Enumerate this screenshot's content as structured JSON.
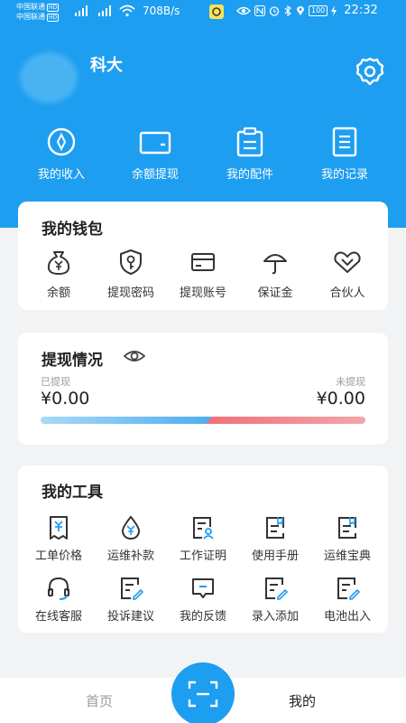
{
  "status_bar": {
    "carrier1": "中国联通",
    "carrier2": "中国联通",
    "hd": "HD",
    "net_speed": "708B/s",
    "battery": "100",
    "time": "22:32"
  },
  "header": {
    "user_name": "科大",
    "quick_actions": [
      {
        "label": "我的收入",
        "icon": "income-icon"
      },
      {
        "label": "余额提现",
        "icon": "wallet-icon"
      },
      {
        "label": "我的配件",
        "icon": "clipboard-icon"
      },
      {
        "label": "我的记录",
        "icon": "record-icon"
      }
    ]
  },
  "wallet": {
    "title": "我的钱包",
    "items": [
      {
        "label": "余额",
        "icon": "money-bag-icon"
      },
      {
        "label": "提现密码",
        "icon": "shield-key-icon"
      },
      {
        "label": "提现账号",
        "icon": "card-icon"
      },
      {
        "label": "保证金",
        "icon": "umbrella-icon"
      },
      {
        "label": "合伙人",
        "icon": "handshake-icon"
      }
    ]
  },
  "withdraw": {
    "title": "提现情况",
    "withdrawn_label": "已提现",
    "withdrawn_amount": "¥0.00",
    "pending_label": "未提现",
    "pending_amount": "¥0.00"
  },
  "tools": {
    "title": "我的工具",
    "items": [
      {
        "label": "工单价格",
        "icon": "price-doc-icon"
      },
      {
        "label": "运维补款",
        "icon": "money-drop-icon"
      },
      {
        "label": "工作证明",
        "icon": "certificate-icon"
      },
      {
        "label": "使用手册",
        "icon": "manual-icon"
      },
      {
        "label": "运维宝典",
        "icon": "guide-book-icon"
      },
      {
        "label": "在线客服",
        "icon": "headset-icon"
      },
      {
        "label": "投诉建议",
        "icon": "complaint-icon"
      },
      {
        "label": "我的反馈",
        "icon": "feedback-icon"
      },
      {
        "label": "录入添加",
        "icon": "entry-add-icon"
      },
      {
        "label": "电池出入",
        "icon": "battery-io-icon"
      }
    ]
  },
  "bottom_nav": {
    "home": "首页",
    "mine": "我的"
  },
  "colors": {
    "primary": "#1e9ef0",
    "page_bg": "#f2f3f5",
    "bar_left": "#49acef",
    "bar_right": "#ef6f78"
  }
}
